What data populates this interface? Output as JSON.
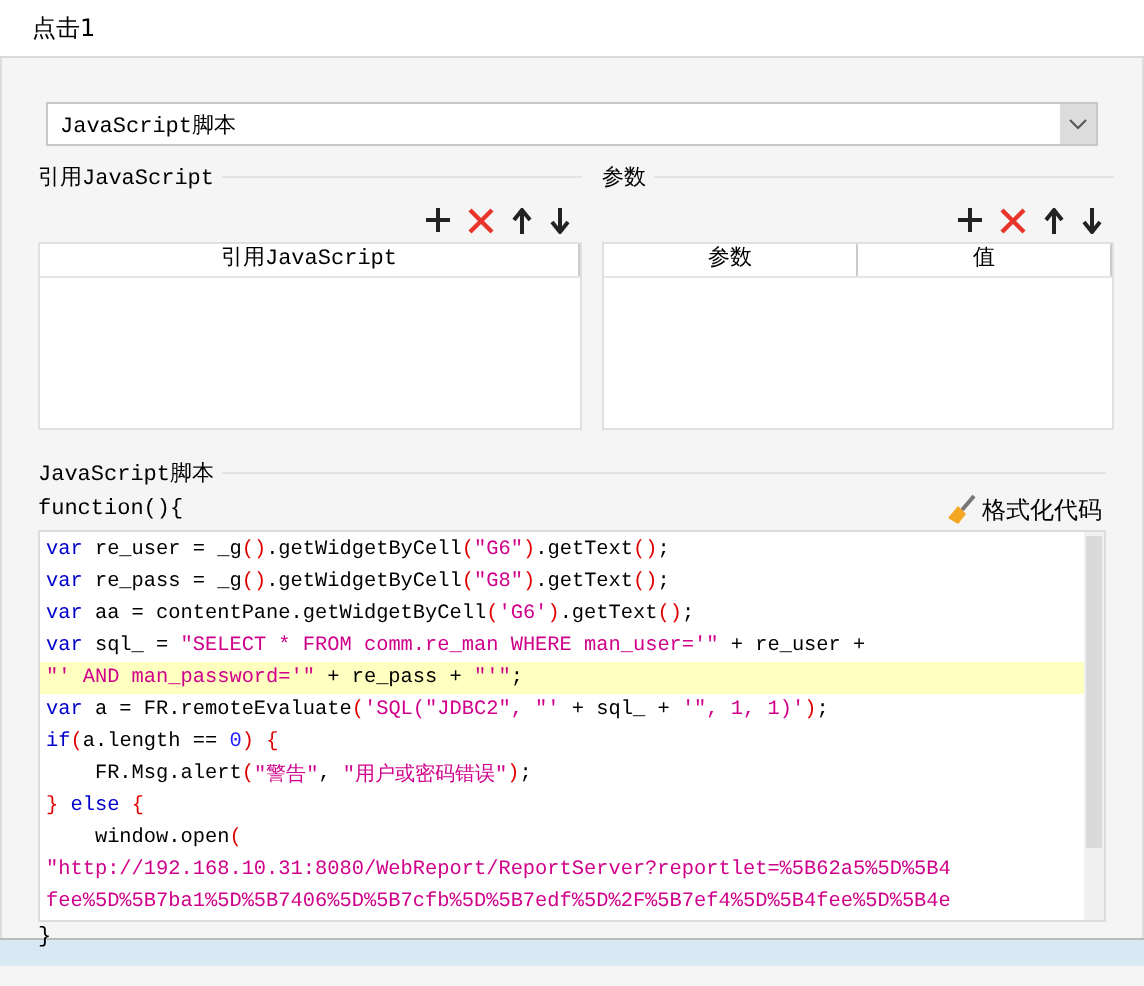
{
  "window": {
    "title": "点击1"
  },
  "script_type": {
    "value": "JavaScript脚本"
  },
  "reference_panel": {
    "title": "引用JavaScript",
    "columns": [
      "引用JavaScript"
    ]
  },
  "params_panel": {
    "title": "参数",
    "columns": [
      "参数",
      "值"
    ]
  },
  "script_section": {
    "title": "JavaScript脚本",
    "header": "function(){",
    "format_button": "格式化代码",
    "footer": "}",
    "lines": [
      {
        "highlighted": false,
        "tokens": [
          {
            "kind": "kw",
            "text": "var"
          },
          {
            "kind": "plain",
            "text": " re_user = _g"
          },
          {
            "kind": "punc",
            "text": "()"
          },
          {
            "kind": "plain",
            "text": ".getWidgetByCell"
          },
          {
            "kind": "punc",
            "text": "("
          },
          {
            "kind": "str",
            "text": "\"G6\""
          },
          {
            "kind": "punc",
            "text": ")"
          },
          {
            "kind": "plain",
            "text": ".getText"
          },
          {
            "kind": "punc",
            "text": "()"
          },
          {
            "kind": "plain",
            "text": ";"
          }
        ]
      },
      {
        "highlighted": false,
        "tokens": [
          {
            "kind": "kw",
            "text": "var"
          },
          {
            "kind": "plain",
            "text": " re_pass = _g"
          },
          {
            "kind": "punc",
            "text": "()"
          },
          {
            "kind": "plain",
            "text": ".getWidgetByCell"
          },
          {
            "kind": "punc",
            "text": "("
          },
          {
            "kind": "str",
            "text": "\"G8\""
          },
          {
            "kind": "punc",
            "text": ")"
          },
          {
            "kind": "plain",
            "text": ".getText"
          },
          {
            "kind": "punc",
            "text": "()"
          },
          {
            "kind": "plain",
            "text": ";"
          }
        ]
      },
      {
        "highlighted": false,
        "tokens": [
          {
            "kind": "kw",
            "text": "var"
          },
          {
            "kind": "plain",
            "text": " aa = contentPane.getWidgetByCell"
          },
          {
            "kind": "punc",
            "text": "("
          },
          {
            "kind": "str",
            "text": "'G6'"
          },
          {
            "kind": "punc",
            "text": ")"
          },
          {
            "kind": "plain",
            "text": ".getText"
          },
          {
            "kind": "punc",
            "text": "()"
          },
          {
            "kind": "plain",
            "text": ";"
          }
        ]
      },
      {
        "highlighted": false,
        "tokens": [
          {
            "kind": "kw",
            "text": "var"
          },
          {
            "kind": "plain",
            "text": " sql_ = "
          },
          {
            "kind": "str",
            "text": "\"SELECT * FROM comm.re_man WHERE man_user='\""
          },
          {
            "kind": "plain",
            "text": " + re_user +"
          }
        ]
      },
      {
        "highlighted": true,
        "tokens": [
          {
            "kind": "str",
            "text": "\"' AND man_password='\""
          },
          {
            "kind": "plain",
            "text": " + re_pass + "
          },
          {
            "kind": "str",
            "text": "\"'\""
          },
          {
            "kind": "plain",
            "text": ";"
          }
        ]
      },
      {
        "highlighted": false,
        "tokens": [
          {
            "kind": "kw",
            "text": "var"
          },
          {
            "kind": "plain",
            "text": " a = FR.remoteEvaluate"
          },
          {
            "kind": "punc",
            "text": "("
          },
          {
            "kind": "str",
            "text": "'SQL(\"JDBC2\", \"'"
          },
          {
            "kind": "plain",
            "text": " + sql_ + "
          },
          {
            "kind": "str",
            "text": "'\", 1, 1)'"
          },
          {
            "kind": "punc",
            "text": ")"
          },
          {
            "kind": "plain",
            "text": ";"
          }
        ]
      },
      {
        "highlighted": false,
        "tokens": [
          {
            "kind": "kw",
            "text": "if"
          },
          {
            "kind": "punc",
            "text": "("
          },
          {
            "kind": "plain",
            "text": "a.length == "
          },
          {
            "kind": "num",
            "text": "0"
          },
          {
            "kind": "punc",
            "text": ") {"
          }
        ]
      },
      {
        "highlighted": false,
        "tokens": [
          {
            "kind": "plain",
            "text": "    FR.Msg.alert"
          },
          {
            "kind": "punc",
            "text": "("
          },
          {
            "kind": "str",
            "text": "\"警告\""
          },
          {
            "kind": "plain",
            "text": ", "
          },
          {
            "kind": "str",
            "text": "\"用户或密码错误\""
          },
          {
            "kind": "punc",
            "text": ")"
          },
          {
            "kind": "plain",
            "text": ";"
          }
        ]
      },
      {
        "highlighted": false,
        "tokens": [
          {
            "kind": "punc",
            "text": "} "
          },
          {
            "kind": "kw",
            "text": "else"
          },
          {
            "kind": "punc",
            "text": " {"
          }
        ]
      },
      {
        "highlighted": false,
        "tokens": [
          {
            "kind": "plain",
            "text": "    window.open"
          },
          {
            "kind": "punc",
            "text": "("
          }
        ]
      },
      {
        "highlighted": false,
        "tokens": [
          {
            "kind": "str",
            "text": "\"http://192.168.10.31:8080/WebReport/ReportServer?reportlet=%5B62a5%5D%5B4"
          }
        ]
      },
      {
        "highlighted": false,
        "tokens": [
          {
            "kind": "str",
            "text": "fee%5D%5B7ba1%5D%5B7406%5D%5B7cfb%5D%5B7edf%5D%2F%5B7ef4%5D%5B4fee%5D%5B4e"
          }
        ]
      }
    ]
  }
}
